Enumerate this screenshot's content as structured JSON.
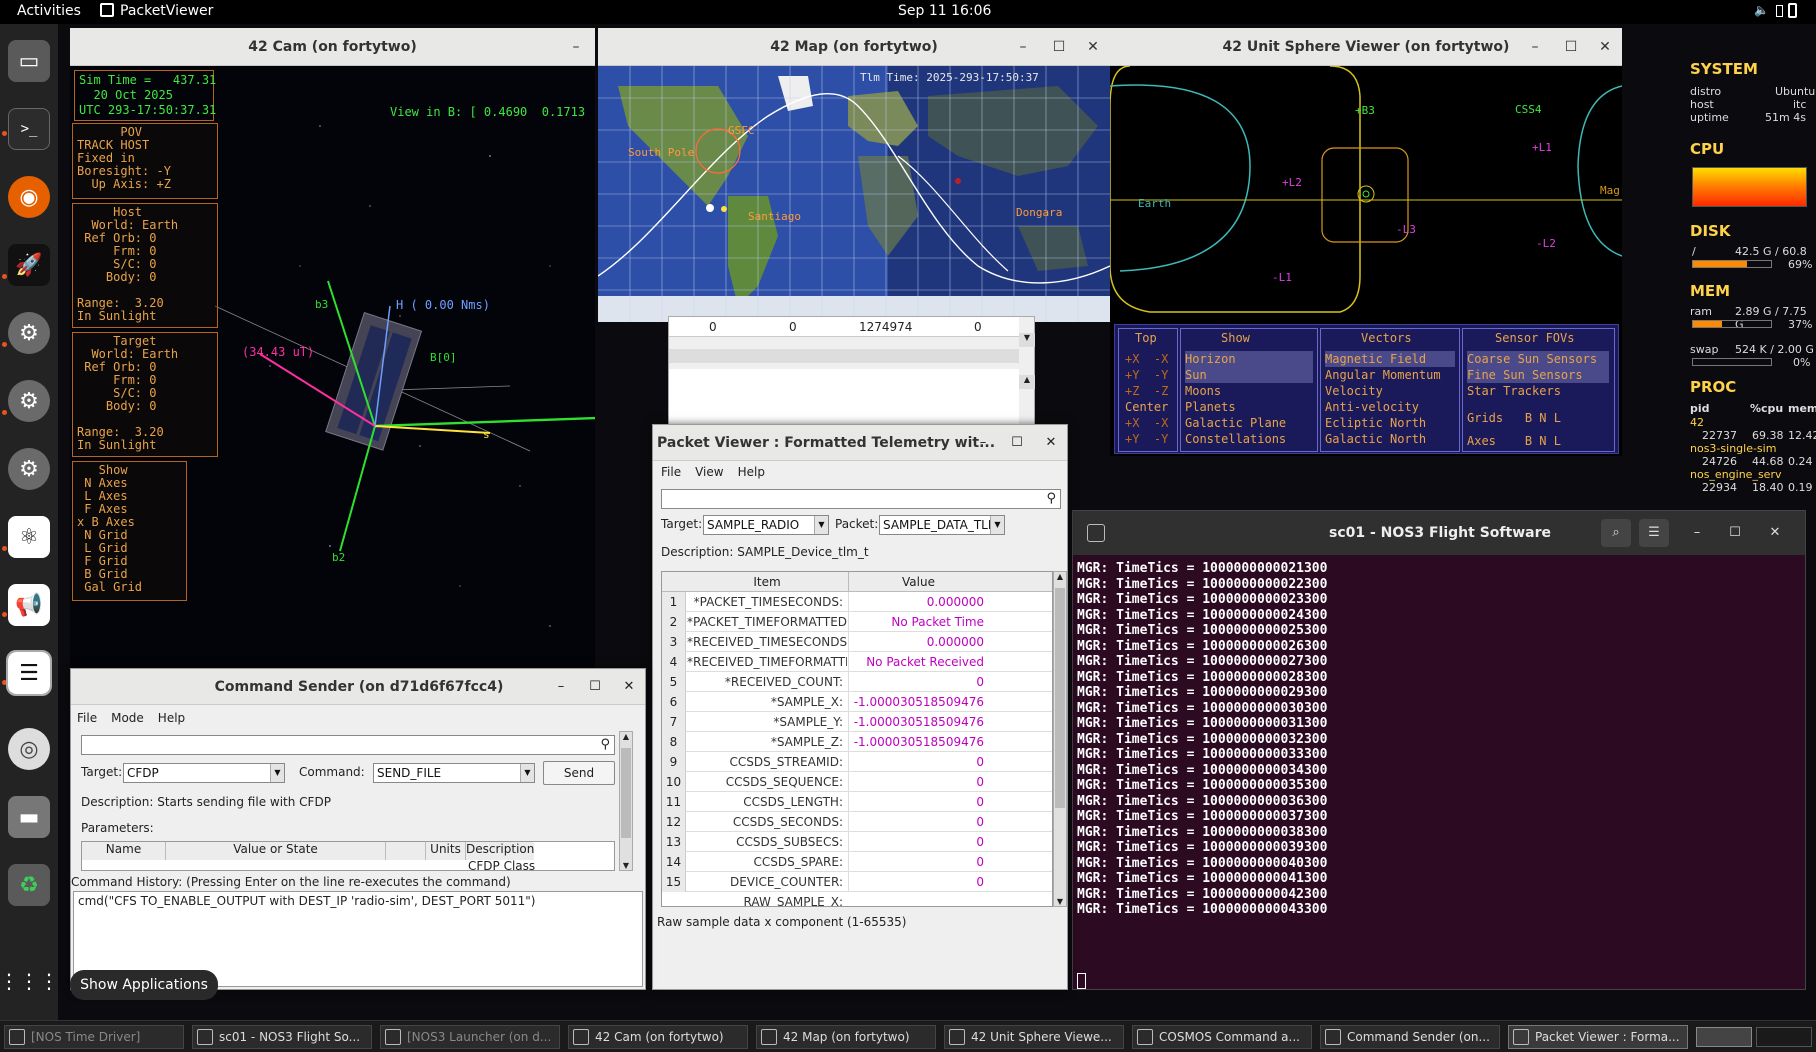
{
  "topbar": {
    "activities": "Activities",
    "app_name": "PacketViewer",
    "clock": "Sep 11  16:06"
  },
  "dock": {
    "show_apps_tooltip": "Show Applications"
  },
  "cam": {
    "title": "42 Cam (on fortytwo)",
    "sim_time": "Sim Time =   437.31\n  20 Oct 2025\nUTC 293-17:50:37.31",
    "view_in_b": "View in B: [ 0.4690  0.1713",
    "pov": "      POV\nTRACK HOST\nFixed in\nBoresight: -Y\n  Up Axis: +Z",
    "host": "     Host\n  World: Earth\n Ref Orb: 0\n     Frm: 0\n     S/C: 0\n    Body: 0\n\nRange:  3.20\nIn Sunlight",
    "target": "     Target\n  World: Earth\n Ref Orb: 0\n     Frm: 0\n     S/C: 0\n    Body: 0\n\nRange:  3.20\nIn Sunlight",
    "show": "   Show\n N Axes\n L Axes\n F Axes\nx B Axes\n N Grid\n L Grid\n F Grid\n B Grid\n Gal Grid",
    "h_label": "H ( 0.00 Nms)",
    "b0_label": "B[0]",
    "torque_label": "(34.43 uT)",
    "axis_b1": "b1",
    "axis_b2": "b2",
    "axis_b3": "b3",
    "axis_s": "s"
  },
  "map": {
    "title": "42 Map (on fortytwo)",
    "tlm_time": "Tlm Time:  2025-293-17:50:37",
    "labels": {
      "gsfc": "GSFC",
      "south_pole": "South Pole",
      "santiago": "Santiago",
      "dongara": "Dongara"
    },
    "under_row": [
      "0",
      "0",
      "1274974",
      "0"
    ]
  },
  "sphere": {
    "title": "42 Unit Sphere Viewer (on fortytwo)",
    "markers": [
      "+B3",
      "CSS4",
      "+L1",
      "+L2",
      "-L3",
      "-L2",
      "-L1",
      "Earth",
      "Mag"
    ],
    "menu": {
      "top": {
        "head": "Top",
        "rows": [
          "+X  -X",
          "+Y  -Y",
          "+Z  -Z",
          "Center",
          "+X  -X",
          "+Y  -Y"
        ]
      },
      "show": {
        "head": "Show",
        "rows": [
          "Horizon",
          "Sun",
          "Moons",
          "Planets",
          "Galactic Plane",
          "Constellations"
        ]
      },
      "vectors": {
        "head": "Vectors",
        "rows": [
          "Magnetic Field",
          "Angular Momentum",
          "Velocity",
          "Anti-velocity",
          "Ecliptic North",
          "Galactic North"
        ]
      },
      "fovs": {
        "head": "Sensor FOVs",
        "rows": [
          "Coarse Sun Sensors",
          "Fine Sun Sensors",
          "Star Trackers"
        ]
      },
      "grids": "Grids",
      "axes": "Axes",
      "bnl": [
        "B",
        "N",
        "L"
      ]
    }
  },
  "sysmon": {
    "system": "SYSTEM",
    "distro_k": "distro",
    "distro_v": "Ubuntu",
    "host_k": "host",
    "host_v": "itc",
    "uptime_k": "uptime",
    "uptime_v": "51m 4s",
    "cpu": "CPU",
    "disk": "DISK",
    "disk_mount": "/",
    "disk_used": "42.5 G / 60.8 G",
    "disk_pct": "69%",
    "disk_frac": 0.69,
    "mem": "MEM",
    "ram_k": "ram",
    "ram_v": "2.89 G / 7.75 G",
    "ram_pct": "37%",
    "ram_frac": 0.37,
    "swap_k": "swap",
    "swap_v": "524 K / 2.00 G",
    "swap_pct": "0%",
    "swap_frac": 0.0,
    "proc": "PROC",
    "proc_head": [
      "pid",
      "%cpu",
      "mem"
    ],
    "procs": [
      {
        "name": "42",
        "pid": "22737",
        "cpu": "69.38",
        "mem": "12.42"
      },
      {
        "name": "nos3-single-sim",
        "pid": "24726",
        "cpu": "44.68",
        "mem": "0.24"
      },
      {
        "name": "nos_engine_serv",
        "pid": "22934",
        "cpu": "18.40",
        "mem": "0.19"
      }
    ]
  },
  "terminal": {
    "title": "sc01 - NOS3 Flight Software",
    "lines": [
      "MGR: TimeTics = 1000000000021300",
      "MGR: TimeTics = 1000000000022300",
      "MGR: TimeTics = 1000000000023300",
      "MGR: TimeTics = 1000000000024300",
      "MGR: TimeTics = 1000000000025300",
      "MGR: TimeTics = 1000000000026300",
      "MGR: TimeTics = 1000000000027300",
      "MGR: TimeTics = 1000000000028300",
      "MGR: TimeTics = 1000000000029300",
      "MGR: TimeTics = 1000000000030300",
      "MGR: TimeTics = 1000000000031300",
      "MGR: TimeTics = 1000000000032300",
      "MGR: TimeTics = 1000000000033300",
      "MGR: TimeTics = 1000000000034300",
      "MGR: TimeTics = 1000000000035300",
      "MGR: TimeTics = 1000000000036300",
      "MGR: TimeTics = 1000000000037300",
      "MGR: TimeTics = 1000000000038300",
      "MGR: TimeTics = 1000000000039300",
      "MGR: TimeTics = 1000000000040300",
      "MGR: TimeTics = 1000000000041300",
      "MGR: TimeTics = 1000000000042300",
      "MGR: TimeTics = 1000000000043300"
    ]
  },
  "packet_viewer": {
    "title": "Packet Viewer : Formatted Telemetry wit...",
    "menu": [
      "File",
      "View",
      "Help"
    ],
    "target_label": "Target:",
    "target_value": "SAMPLE_RADIO",
    "packet_label": "Packet:",
    "packet_value": "SAMPLE_DATA_TLM",
    "description": "Description:  SAMPLE_Device_tlm_t",
    "col_item": "Item",
    "col_value": "Value",
    "rows": [
      {
        "n": "1",
        "item": "*PACKET_TIMESECONDS:",
        "value": "0.000000"
      },
      {
        "n": "2",
        "item": "*PACKET_TIMEFORMATTED:",
        "value": "No Packet Time"
      },
      {
        "n": "3",
        "item": "*RECEIVED_TIMESECONDS:",
        "value": "0.000000"
      },
      {
        "n": "4",
        "item": "*RECEIVED_TIMEFORMATTED:",
        "value": "No Packet Received Time"
      },
      {
        "n": "5",
        "item": "*RECEIVED_COUNT:",
        "value": "0"
      },
      {
        "n": "6",
        "item": "*SAMPLE_X:",
        "value": "-1.000030518509476"
      },
      {
        "n": "7",
        "item": "*SAMPLE_Y:",
        "value": "-1.000030518509476"
      },
      {
        "n": "8",
        "item": "*SAMPLE_Z:",
        "value": "-1.000030518509476"
      },
      {
        "n": "9",
        "item": "CCSDS_STREAMID:",
        "value": "0"
      },
      {
        "n": "10",
        "item": "CCSDS_SEQUENCE:",
        "value": "0"
      },
      {
        "n": "11",
        "item": "CCSDS_LENGTH:",
        "value": "0"
      },
      {
        "n": "12",
        "item": "CCSDS_SECONDS:",
        "value": "0"
      },
      {
        "n": "13",
        "item": "CCSDS_SUBSECS:",
        "value": "0"
      },
      {
        "n": "14",
        "item": "CCSDS_SPARE:",
        "value": "0"
      },
      {
        "n": "15",
        "item": "DEVICE_COUNTER:",
        "value": "0"
      }
    ],
    "partial_row": "RAW_SAMPLE_X:",
    "status": "Raw sample data x component (1-65535)"
  },
  "cmd_sender": {
    "title": "Command Sender (on d71d6f67fcc4)",
    "menu": [
      "File",
      "Mode",
      "Help"
    ],
    "target_label": "Target:",
    "target_value": "CFDP",
    "command_label": "Command:",
    "command_value": "SEND_FILE",
    "send": "Send",
    "description": "Description:  Starts sending file with CFDP",
    "params_label": "Parameters:",
    "param_cols": [
      "Name",
      "Value or State",
      "",
      "Units",
      "Description"
    ],
    "param_desc_partial": "CFDP Class",
    "history_label": "Command History: (Pressing Enter on the line re-executes the command)",
    "history_line": "cmd(\"CFS TO_ENABLE_OUTPUT with DEST_IP 'radio-sim', DEST_PORT 5011\")"
  },
  "taskbar": [
    "[NOS Time Driver]",
    "sc01 - NOS3 Flight So...",
    "[NOS3 Launcher (on d...",
    "42 Cam (on fortytwo)",
    "42 Map (on fortytwo)",
    "42 Unit Sphere Viewe...",
    "COSMOS Command a...",
    "Command Sender (on...",
    "Packet Viewer : Forma..."
  ]
}
